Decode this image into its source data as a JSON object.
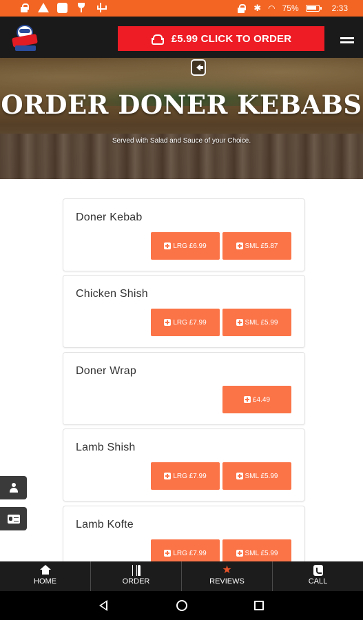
{
  "status_bar": {
    "battery": "75%",
    "time": "2:33"
  },
  "header": {
    "order_button_label": "£5.99 CLICK TO ORDER"
  },
  "hero": {
    "title": "ORDER DONER KEBABS",
    "subtitle": "Served with Salad and Sauce of your Choice."
  },
  "menu": {
    "items": [
      {
        "name": "Doner Kebab",
        "large": "LRG £6.99",
        "small": "SML £5.87"
      },
      {
        "name": "Chicken Shish",
        "large": "LRG £7.99",
        "small": "SML £5.99"
      },
      {
        "name": "Doner Wrap",
        "single": "£4.49"
      },
      {
        "name": "Lamb Shish",
        "large": "LRG £7.99",
        "small": "SML £5.99"
      },
      {
        "name": "Lamb Kofte",
        "large": "LRG £7.99",
        "small": "SML £5.99"
      }
    ]
  },
  "tab_bar": {
    "home": "HOME",
    "order": "ORDER",
    "reviews": "REVIEWS",
    "call": "CALL"
  },
  "colors": {
    "status_bar": "#f26522",
    "nav_bg": "#1a1a1a",
    "order_button": "#ee1c25",
    "price_button": "#fb7448",
    "reviews_star": "#e8532a"
  }
}
